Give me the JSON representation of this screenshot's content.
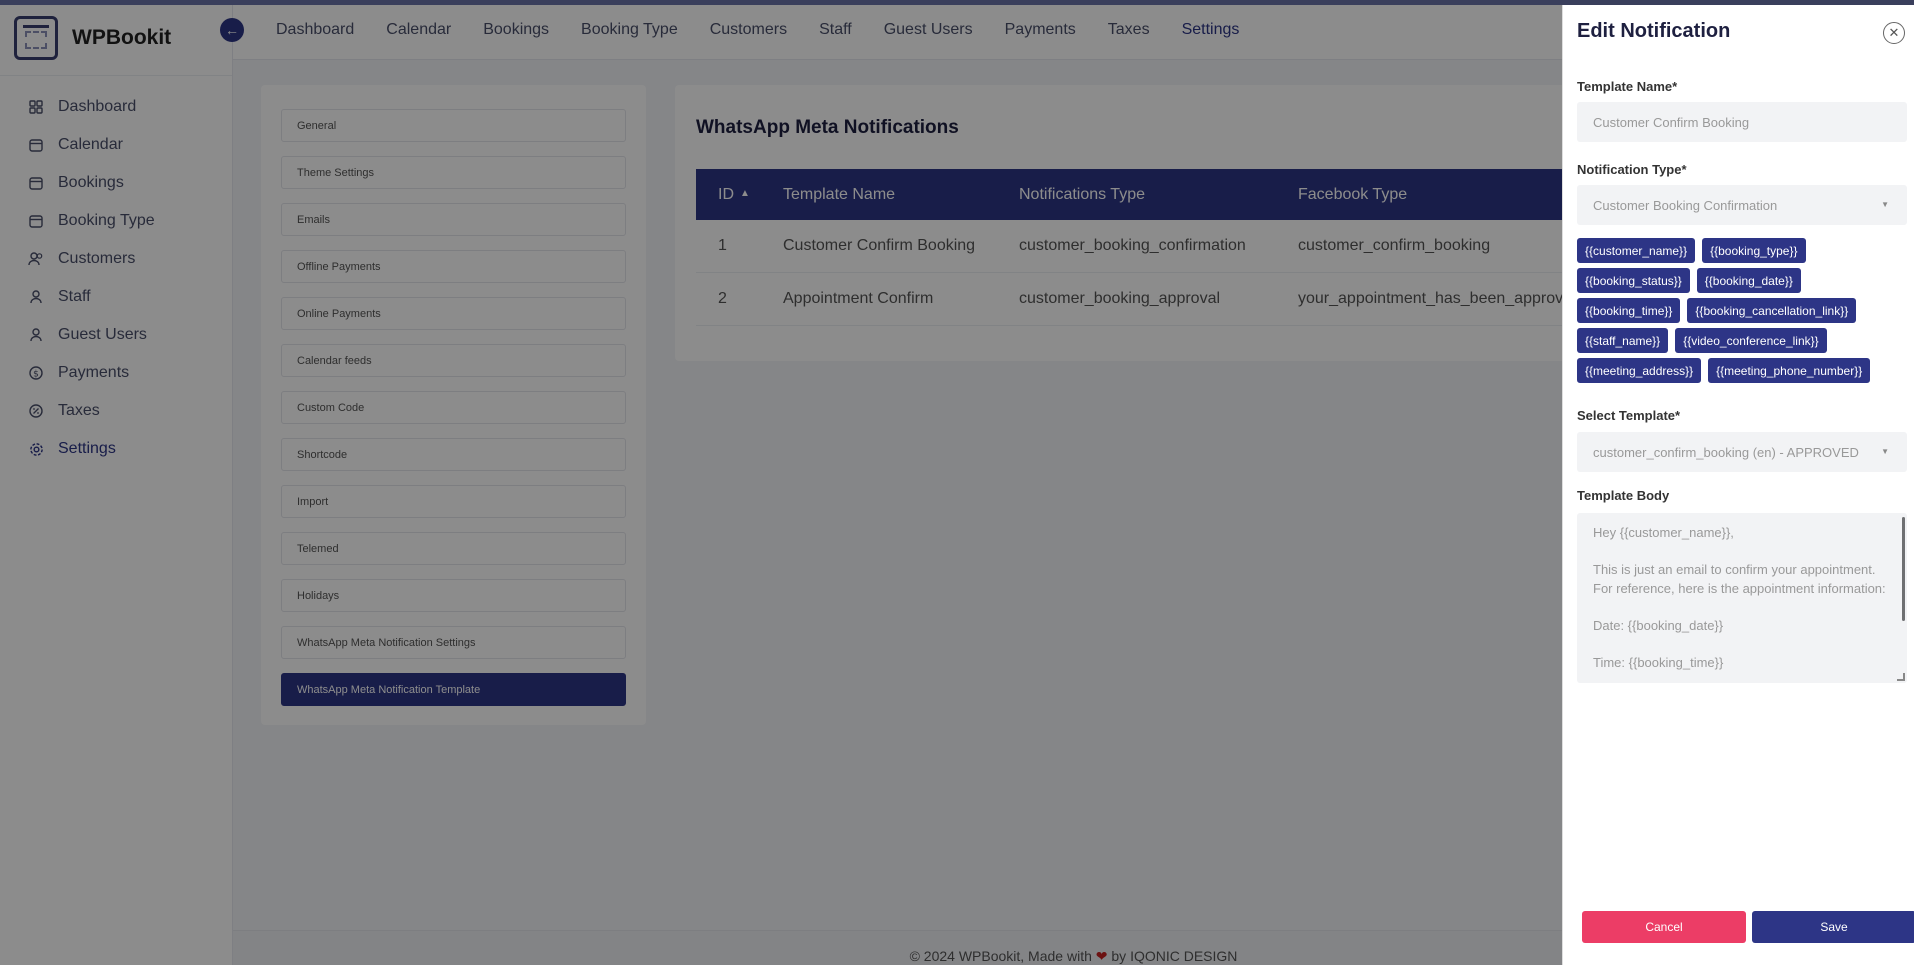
{
  "app": {
    "name": "WPBookit"
  },
  "sidebar": {
    "items": [
      {
        "label": "Dashboard",
        "icon": "grid-icon"
      },
      {
        "label": "Calendar",
        "icon": "calendar-icon"
      },
      {
        "label": "Bookings",
        "icon": "calendar-icon"
      },
      {
        "label": "Booking Type",
        "icon": "calendar-icon"
      },
      {
        "label": "Customers",
        "icon": "users-icon"
      },
      {
        "label": "Staff",
        "icon": "user-icon"
      },
      {
        "label": "Guest Users",
        "icon": "user-icon"
      },
      {
        "label": "Payments",
        "icon": "dollar-circle-icon"
      },
      {
        "label": "Taxes",
        "icon": "percent-icon"
      },
      {
        "label": "Settings",
        "icon": "gear-icon",
        "active": true
      }
    ]
  },
  "topnav": {
    "tabs": [
      "Dashboard",
      "Calendar",
      "Bookings",
      "Booking Type",
      "Customers",
      "Staff",
      "Guest Users",
      "Payments",
      "Taxes",
      "Settings"
    ],
    "active": "Settings"
  },
  "settings_menu": {
    "items": [
      "General",
      "Theme Settings",
      "Emails",
      "Offline Payments",
      "Online Payments",
      "Calendar feeds",
      "Custom Code",
      "Shortcode",
      "Import",
      "Telemed",
      "Holidays",
      "WhatsApp Meta Notification Settings",
      "WhatsApp Meta Notification Template"
    ],
    "active": "WhatsApp Meta Notification Template"
  },
  "main": {
    "title": "WhatsApp Meta Notifications",
    "columns": [
      "ID",
      "Template Name",
      "Notifications Type",
      "Facebook Type"
    ],
    "rows": [
      [
        "1",
        "Customer Confirm Booking",
        "customer_booking_confirmation",
        "customer_confirm_booking"
      ],
      [
        "2",
        "Appointment Confirm",
        "customer_booking_approval",
        "your_appointment_has_been_approved"
      ]
    ]
  },
  "footer": {
    "prefix": "© 2024 WPBookit, Made with",
    "suffix": "by IQONIC DESIGN"
  },
  "drawer": {
    "title": "Edit Notification",
    "template_name_label": "Template Name*",
    "template_name_value": "Customer Confirm Booking",
    "notification_type_label": "Notification Type*",
    "notification_type_value": "Customer Booking Confirmation",
    "chips": [
      "{{customer_name}}",
      "{{booking_type}}",
      "{{booking_status}}",
      "{{booking_date}}",
      "{{booking_time}}",
      "{{booking_cancellation_link}}",
      "{{staff_name}}",
      "{{video_conference_link}}",
      "{{meeting_address}}",
      "{{meeting_phone_number}}"
    ],
    "select_template_label": "Select Template*",
    "select_template_value": "customer_confirm_booking (en) - APPROVED",
    "template_body_label": "Template Body",
    "template_body_lines": [
      "Hey {{customer_name}},",
      "",
      "This is just an email to confirm your appointment. For reference, here is the appointment information:",
      "",
      "Date: {{booking_date}}",
      "",
      "Time: {{booking_time}}"
    ],
    "cancel_label": "Cancel",
    "save_label": "Save"
  },
  "colors": {
    "primary": "#2d3586",
    "danger": "#ec3d66",
    "overlay": "rgba(0,0,0,0.45)"
  }
}
